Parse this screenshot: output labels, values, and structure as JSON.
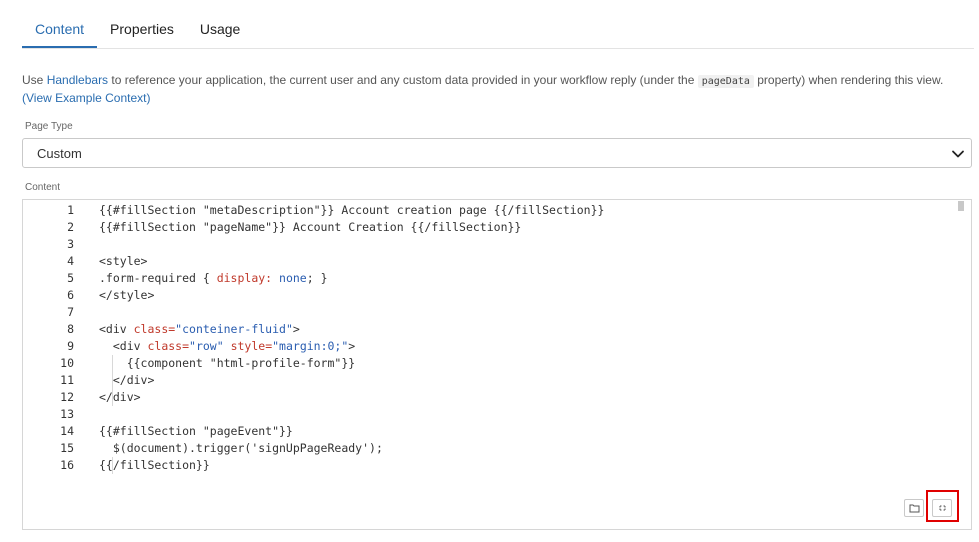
{
  "tabs": [
    {
      "label": "Content",
      "active": true
    },
    {
      "label": "Properties",
      "active": false
    },
    {
      "label": "Usage",
      "active": false
    }
  ],
  "description": {
    "part1": "Use ",
    "link_handlebars": "Handlebars",
    "part2": " to reference your application, the current user and any custom data provided in your workflow reply (under the ",
    "code": "pageData",
    "part3": " property) when rendering this view.",
    "link_example": "(View Example Context)"
  },
  "page_type": {
    "label": "Page Type",
    "value": "Custom"
  },
  "content_label": "Content",
  "editor": {
    "line_numbers": [
      "1",
      "2",
      "3",
      "4",
      "5",
      "6",
      "7",
      "8",
      "9",
      "10",
      "11",
      "12",
      "13",
      "14",
      "15",
      "16"
    ],
    "lines": [
      [
        {
          "t": "{{#fillSection \"metaDescription\"}} Account creation page {{/fillSection}}"
        }
      ],
      [
        {
          "t": "{{#fillSection \"pageName\"}} Account Creation {{/fillSection}}"
        }
      ],
      [],
      [
        {
          "t": "<style>"
        }
      ],
      [
        {
          "t": ".form-required { "
        },
        {
          "t": "display:",
          "c": "red"
        },
        {
          "t": " "
        },
        {
          "t": "none",
          "c": "blue"
        },
        {
          "t": "; }"
        }
      ],
      [
        {
          "t": "</style>"
        }
      ],
      [],
      [
        {
          "t": "<div "
        },
        {
          "t": "class=",
          "c": "red"
        },
        {
          "t": "\"conteiner-fluid\"",
          "c": "blue"
        },
        {
          "t": ">"
        }
      ],
      [
        {
          "t": "  <div "
        },
        {
          "t": "class=",
          "c": "red"
        },
        {
          "t": "\"row\"",
          "c": "blue"
        },
        {
          "t": " "
        },
        {
          "t": "style=",
          "c": "red"
        },
        {
          "t": "\"margin:0;\"",
          "c": "blue"
        },
        {
          "t": ">"
        }
      ],
      [
        {
          "t": "    {{component \"html-profile-form\"}}"
        }
      ],
      [
        {
          "t": "  </div>"
        }
      ],
      [
        {
          "t": "</div>"
        }
      ],
      [],
      [
        {
          "t": "{{#fillSection \"pageEvent\"}}"
        }
      ],
      [
        {
          "t": "  $(document).trigger('signUpPageReady');"
        }
      ],
      [
        {
          "t": "{{/fillSection}}"
        }
      ]
    ]
  },
  "colors": {
    "accent": "#2a6db0",
    "code_attr": "#c0392b",
    "code_value": "#2a5db0",
    "highlight": "#e00000"
  },
  "icons": {
    "folder": "folder-icon",
    "fullscreen": "fullscreen-icon",
    "select_arrow": "chevron-down-icon"
  }
}
